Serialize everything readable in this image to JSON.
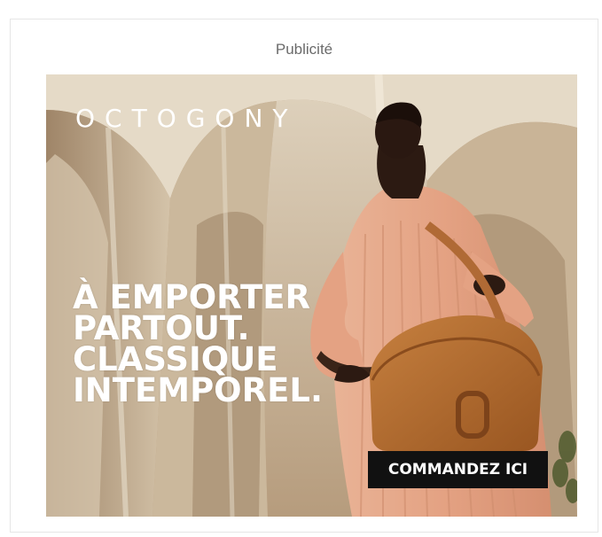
{
  "ad": {
    "label": "Publicité",
    "brand": "OCTOGONY",
    "headline": [
      "À EMPORTER",
      "PARTOUT.",
      "CLASSIQUE",
      "INTEMPOREL."
    ],
    "cta_label": "COMMANDEZ ICI"
  },
  "colors": {
    "label_text": "#6b6b6b",
    "cta_background": "#111111",
    "cta_text": "#ffffff",
    "headline_text": "#ffffff",
    "dress": "#e8a98a",
    "bag": "#b06a35"
  }
}
